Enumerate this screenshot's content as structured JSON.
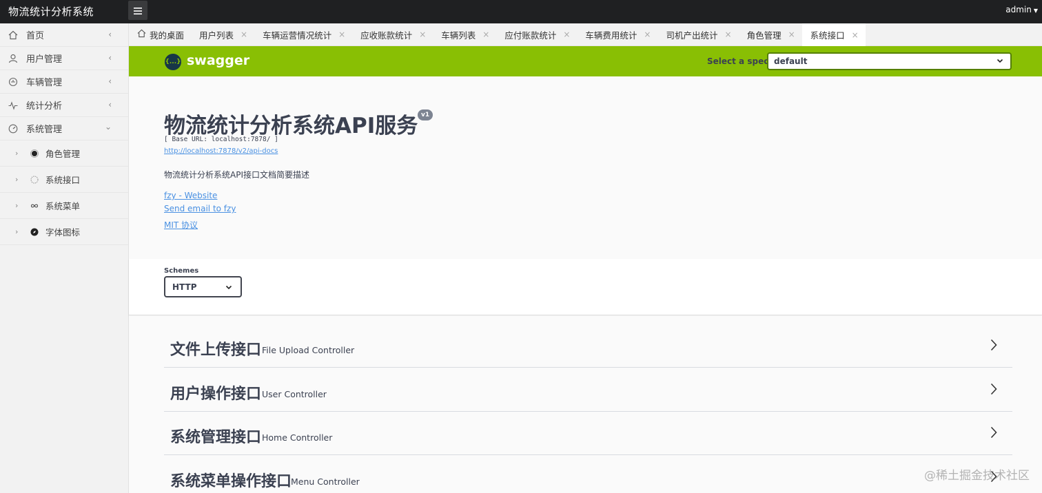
{
  "topbar": {
    "title": "物流统计分析系统",
    "user": "admin"
  },
  "sidebar": {
    "items": [
      {
        "label": "首页",
        "icon": "home-icon",
        "expanded": false
      },
      {
        "label": "用户管理",
        "icon": "user-icon",
        "expanded": false
      },
      {
        "label": "车辆管理",
        "icon": "vehicle-icon",
        "expanded": false
      },
      {
        "label": "统计分析",
        "icon": "pulse-icon",
        "expanded": false
      },
      {
        "label": "系统管理",
        "icon": "dashboard-icon",
        "expanded": true
      }
    ],
    "subitems": [
      {
        "label": "角色管理",
        "icon": "circle-dot-icon"
      },
      {
        "label": "系统接口",
        "icon": "dashed-circle-icon"
      },
      {
        "label": "系统菜单",
        "icon": "infinity-icon"
      },
      {
        "label": "字体图标",
        "icon": "compass-icon"
      }
    ]
  },
  "tabs": [
    {
      "label": "我的桌面",
      "closable": false
    },
    {
      "label": "用户列表",
      "closable": true
    },
    {
      "label": "车辆运营情况统计",
      "closable": true
    },
    {
      "label": "应收账款统计",
      "closable": true
    },
    {
      "label": "车辆列表",
      "closable": true
    },
    {
      "label": "应付账款统计",
      "closable": true
    },
    {
      "label": "车辆费用统计",
      "closable": true
    },
    {
      "label": "司机产出统计",
      "closable": true
    },
    {
      "label": "角色管理",
      "closable": true
    },
    {
      "label": "系统接口",
      "closable": true,
      "active": true
    }
  ],
  "swagger": {
    "logo_text": "{...}",
    "name": "swagger",
    "spec_label": "Select a spec",
    "spec_value": "default",
    "accent_color": "#89bf04"
  },
  "info": {
    "title": "物流统计分析系统API服务",
    "version": "v1",
    "base_url": "[ Base URL: localhost:7878/ ]",
    "api_docs": "http://localhost:7878/v2/api-docs",
    "description": "物流统计分析系统API接口文档简要描述",
    "links": {
      "website": "fzy - Website",
      "email": "Send email to fzy",
      "license": "MIT 协议"
    }
  },
  "schemes": {
    "label": "Schemes",
    "value": "HTTP"
  },
  "controllers": [
    {
      "zh": "文件上传接口",
      "en": "File Upload Controller"
    },
    {
      "zh": "用户操作接口",
      "en": "User Controller"
    },
    {
      "zh": "系统管理接口",
      "en": "Home Controller"
    },
    {
      "zh": "系统菜单操作接口",
      "en": "Menu Controller"
    }
  ],
  "watermark": "@稀土掘金技术社区"
}
